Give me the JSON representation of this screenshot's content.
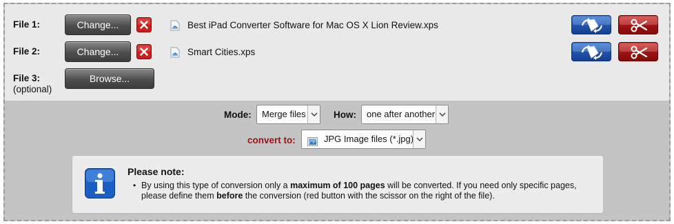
{
  "files": [
    {
      "label": "File 1:",
      "button": "Change...",
      "filename": "Best iPad Converter Software for Mac OS X Lion Review.xps",
      "remove_icon": "red-x-icon",
      "file_icon": "xps-file-icon"
    },
    {
      "label": "File 2:",
      "button": "Change...",
      "filename": "Smart Cities.xps",
      "remove_icon": "red-x-icon",
      "file_icon": "xps-file-icon"
    },
    {
      "label": "File 3:",
      "optional": "(optional)",
      "button": "Browse..."
    }
  ],
  "options": {
    "mode_label": "Mode:",
    "mode_value": "Merge files",
    "how_label": "How:",
    "how_value": "one after another",
    "convert_label": "convert to:",
    "convert_value": "JPG Image files (*.jpg)",
    "convert_icon": "jpg-image-icon"
  },
  "note": {
    "title": "Please note:",
    "text_1": "By using this type of conversion only a ",
    "bold_1": "maximum of 100 pages",
    "text_2": " will be converted. If you need only specific pages, please define them ",
    "bold_2": "before",
    "text_3": " the conversion (red button with the scissor on the right of the file).",
    "icon": "info-icon"
  },
  "colors": {
    "convert_label": "#a01010",
    "action_blue": "#1f4fa8",
    "action_red": "#9c1111"
  }
}
